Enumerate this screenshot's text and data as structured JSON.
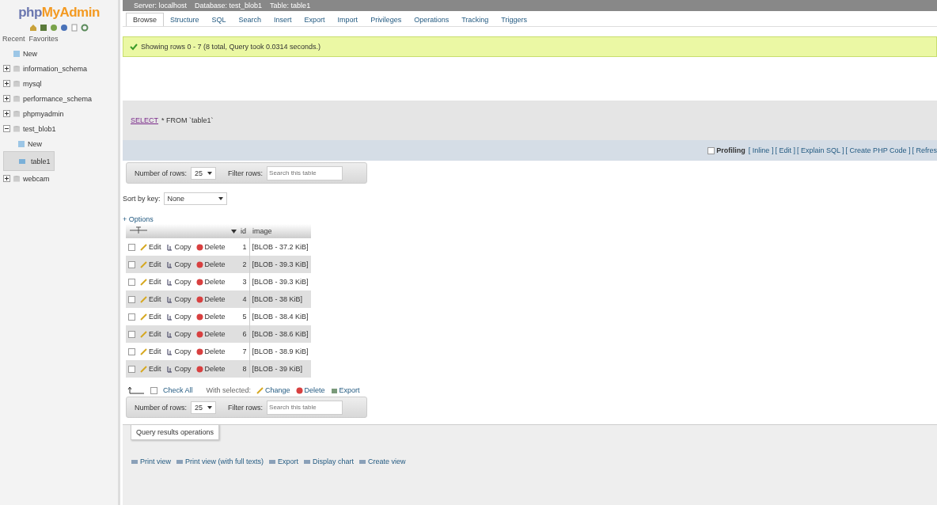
{
  "sidebar": {
    "logo": {
      "part_1": "php",
      "part_2": "MyAdmin"
    },
    "tabs": [
      {
        "label": "Recent",
        "selected": false
      },
      {
        "label": "Favorites",
        "selected": false
      }
    ],
    "tree": [
      {
        "label": "New",
        "kind": "new"
      },
      {
        "label": "information_schema",
        "kind": "db",
        "expanded": false
      },
      {
        "label": "mysql",
        "kind": "db",
        "expanded": false
      },
      {
        "label": "performance_schema",
        "kind": "db",
        "expanded": false
      },
      {
        "label": "phpmyadmin",
        "kind": "db",
        "expanded": false
      },
      {
        "label": "test_blob1",
        "kind": "db",
        "expanded": true,
        "children": [
          {
            "label": "New",
            "kind": "new",
            "selected": false
          },
          {
            "label": "table1",
            "kind": "table",
            "selected": true
          }
        ]
      },
      {
        "label": "webcam",
        "kind": "db",
        "expanded": false
      }
    ]
  },
  "breadcrumb": [
    {
      "label": "Server: localhost"
    },
    {
      "label": "Database: test_blob1"
    },
    {
      "label": "Table: table1"
    }
  ],
  "tabs": [
    {
      "label": "Browse",
      "selected": true
    },
    {
      "label": "Structure",
      "selected": false
    },
    {
      "label": "SQL",
      "selected": false
    },
    {
      "label": "Search",
      "selected": false
    },
    {
      "label": "Insert",
      "selected": false
    },
    {
      "label": "Export",
      "selected": false
    },
    {
      "label": "Import",
      "selected": false
    },
    {
      "label": "Privileges",
      "selected": false
    },
    {
      "label": "Operations",
      "selected": false
    },
    {
      "label": "Tracking",
      "selected": false
    },
    {
      "label": "Triggers",
      "selected": false
    }
  ],
  "message": "Showing rows 0 - 7 (8 total, Query took 0.0314 seconds.)",
  "sql": {
    "keyword_1": "SELECT",
    "rest": "* FROM `table1`"
  },
  "profiling": {
    "checkbox": {
      "label": "Profiling",
      "checked": false
    },
    "links": [
      "[ Inline ]",
      "[ Edit ]",
      "[ Explain SQL ]",
      "[ Create PHP Code ]",
      "[ Refres"
    ]
  },
  "nav_top": {
    "rows_label": "Number of rows:",
    "rows_value": "25",
    "filter_label": "Filter rows:",
    "filter_placeholder": "Search this table"
  },
  "sort": {
    "label": "Sort by key:",
    "value": "None"
  },
  "options_label": "+ Options",
  "table": {
    "columns": [
      "id",
      "image"
    ],
    "rows": [
      {
        "checked": false,
        "edit": "Edit",
        "copy": "Copy",
        "delete": "Delete",
        "id": "1",
        "image": "[BLOB - 37.2 KiB]"
      },
      {
        "checked": false,
        "edit": "Edit",
        "copy": "Copy",
        "delete": "Delete",
        "id": "2",
        "image": "[BLOB - 39.3 KiB]"
      },
      {
        "checked": false,
        "edit": "Edit",
        "copy": "Copy",
        "delete": "Delete",
        "id": "3",
        "image": "[BLOB - 39.3 KiB]"
      },
      {
        "checked": false,
        "edit": "Edit",
        "copy": "Copy",
        "delete": "Delete",
        "id": "4",
        "image": "[BLOB - 38 KiB]"
      },
      {
        "checked": false,
        "edit": "Edit",
        "copy": "Copy",
        "delete": "Delete",
        "id": "5",
        "image": "[BLOB - 38.4 KiB]"
      },
      {
        "checked": false,
        "edit": "Edit",
        "copy": "Copy",
        "delete": "Delete",
        "id": "6",
        "image": "[BLOB - 38.6 KiB]"
      },
      {
        "checked": false,
        "edit": "Edit",
        "copy": "Copy",
        "delete": "Delete",
        "id": "7",
        "image": "[BLOB - 38.9 KiB]"
      },
      {
        "checked": false,
        "edit": "Edit",
        "copy": "Copy",
        "delete": "Delete",
        "id": "8",
        "image": "[BLOB - 39 KiB]"
      }
    ]
  },
  "bulk": {
    "check_all": {
      "label": "Check All",
      "checked": false
    },
    "with_selected": "With selected:",
    "actions": [
      "Change",
      "Delete",
      "Export"
    ]
  },
  "nav_bottom": {
    "rows_label": "Number of rows:",
    "rows_value": "25",
    "filter_label": "Filter rows:",
    "filter_placeholder": "Search this table"
  },
  "query_ops": {
    "legend": "Query results operations",
    "links": [
      "Print view",
      "Print view (with full texts)",
      "Export",
      "Display chart",
      "Create view"
    ]
  }
}
